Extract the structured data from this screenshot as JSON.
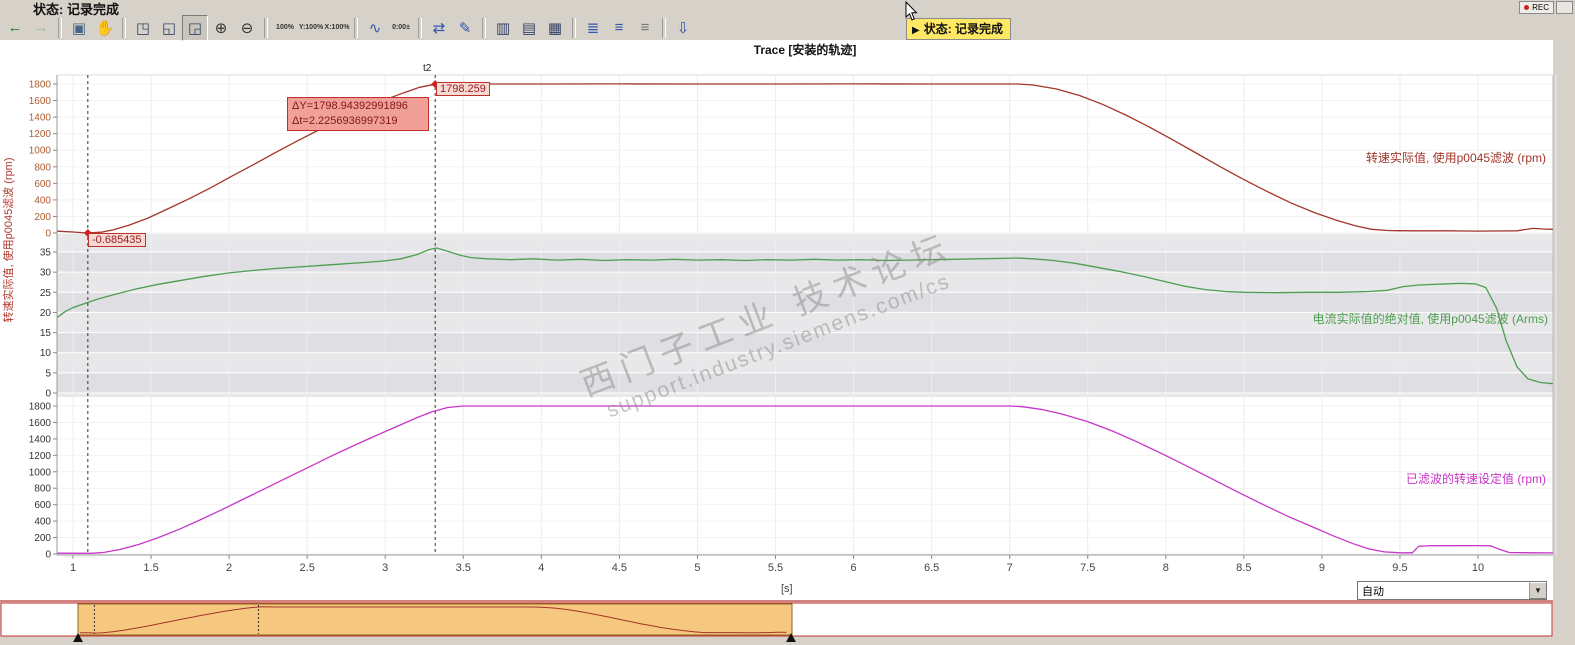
{
  "titlebar": {
    "status_text": "状态: 记录完成",
    "rec_label": "REC"
  },
  "tooltip": {
    "play_glyph": "▶",
    "text": "状态: 记录完成"
  },
  "title": "Trace [安装的轨迹]",
  "left_axis_label": "转速实际值, 使用p0045滤波 (rpm)",
  "toolbar": {
    "buttons": [
      {
        "name": "back-icon",
        "glyph": "←",
        "color": "#1e7d1e"
      },
      {
        "name": "forward-icon",
        "glyph": "→",
        "color": "#8fbf8f"
      },
      {
        "sep": true
      },
      {
        "name": "fit-view-icon",
        "glyph": "▣",
        "color": "#446688"
      },
      {
        "name": "pan-hand-icon",
        "glyph": "✋",
        "color": "#b8860b"
      },
      {
        "sep": true
      },
      {
        "name": "zoom-area-icon",
        "glyph": "◳",
        "color": "#334466"
      },
      {
        "name": "zoom-x-range-icon",
        "glyph": "◱",
        "color": "#334466"
      },
      {
        "name": "zoom-selection-icon",
        "glyph": "◲",
        "color": "#334466",
        "active": true
      },
      {
        "name": "zoom-in-icon",
        "glyph": "⊕",
        "color": "#333333"
      },
      {
        "name": "zoom-out-icon",
        "glyph": "⊖",
        "color": "#333333"
      },
      {
        "sep": true
      },
      {
        "name": "zoom-100-icon",
        "glyph": "100%",
        "color": "#333333",
        "small": true
      },
      {
        "name": "zoom-y-100-icon",
        "glyph": "Y:100%",
        "color": "#333333",
        "small": true
      },
      {
        "name": "zoom-x-100-icon",
        "glyph": "X:100%",
        "color": "#333333",
        "small": true
      },
      {
        "sep": true
      },
      {
        "name": "signal-curve-icon",
        "glyph": "∿",
        "color": "#3355aa"
      },
      {
        "name": "time-offset-icon",
        "glyph": "0:00±",
        "color": "#333333",
        "small": true
      },
      {
        "sep": true
      },
      {
        "name": "swap-axes-icon",
        "glyph": "⇄",
        "color": "#3355aa"
      },
      {
        "name": "draw-line-icon",
        "glyph": "✎",
        "color": "#3355aa"
      },
      {
        "sep": true
      },
      {
        "name": "split-vertical-icon",
        "glyph": "▥",
        "color": "#334466"
      },
      {
        "name": "split-horizontal-icon",
        "glyph": "▤",
        "color": "#334466"
      },
      {
        "name": "zoom-table-icon",
        "glyph": "▦",
        "color": "#334466"
      },
      {
        "sep": true
      },
      {
        "name": "signal-list-icon",
        "glyph": "≣",
        "color": "#3355aa"
      },
      {
        "name": "align-left-icon",
        "glyph": "≡",
        "color": "#3355aa"
      },
      {
        "name": "align-justify-icon",
        "glyph": "≡",
        "color": "#777777"
      },
      {
        "sep": true
      },
      {
        "name": "export-icon",
        "glyph": "⇩",
        "color": "#3355aa"
      }
    ]
  },
  "x_axis": {
    "label": "[s]",
    "ticks": [
      1,
      1.5,
      2,
      2.5,
      3,
      3.5,
      4,
      4.5,
      5,
      5.5,
      6,
      6.5,
      7,
      7.5,
      8,
      8.5,
      9,
      9.5,
      10
    ],
    "xlim": [
      0.9,
      10.5
    ]
  },
  "cursors": {
    "t1": {
      "x": 1.095,
      "value_label": "-0.685435"
    },
    "t2": {
      "x": 3.32,
      "label": "t2",
      "value_label": "1798.259"
    }
  },
  "annotations": {
    "delta_line1": "ΔY=1798.94392991896",
    "delta_line2": "Δt=2.2256936997319"
  },
  "watermark": {
    "line1": "西门子工业  技术论坛",
    "line2": "support.industry.siemens.com/cs"
  },
  "controls": {
    "mode_value": "自动",
    "dropdown_arrow": "▼"
  },
  "chart_data": [
    {
      "type": "line",
      "title": "转速实际值, 使用p0045滤波 (rpm)",
      "color": "#a3352a",
      "label_color": "#b05a2a",
      "ylim": [
        0,
        1800
      ],
      "ytick_step": 200,
      "points": [
        [
          0.9,
          22
        ],
        [
          1.0,
          12
        ],
        [
          1.06,
          4
        ],
        [
          1.1,
          1
        ],
        [
          1.18,
          10
        ],
        [
          1.26,
          40
        ],
        [
          1.36,
          95
        ],
        [
          1.48,
          180
        ],
        [
          1.6,
          285
        ],
        [
          1.74,
          410
        ],
        [
          1.88,
          545
        ],
        [
          2.02,
          690
        ],
        [
          2.16,
          830
        ],
        [
          2.3,
          975
        ],
        [
          2.44,
          1115
        ],
        [
          2.58,
          1250
        ],
        [
          2.72,
          1380
        ],
        [
          2.86,
          1500
        ],
        [
          3.0,
          1610
        ],
        [
          3.12,
          1695
        ],
        [
          3.22,
          1760
        ],
        [
          3.32,
          1798
        ],
        [
          3.38,
          1812
        ],
        [
          3.45,
          1806
        ],
        [
          3.55,
          1800
        ],
        [
          4.0,
          1800
        ],
        [
          4.5,
          1801
        ],
        [
          5.0,
          1800
        ],
        [
          5.5,
          1800
        ],
        [
          6.0,
          1801
        ],
        [
          6.5,
          1800
        ],
        [
          7.0,
          1800
        ],
        [
          7.05,
          1800
        ],
        [
          7.15,
          1788
        ],
        [
          7.3,
          1740
        ],
        [
          7.45,
          1660
        ],
        [
          7.6,
          1550
        ],
        [
          7.75,
          1420
        ],
        [
          7.9,
          1275
        ],
        [
          8.05,
          1120
        ],
        [
          8.2,
          960
        ],
        [
          8.35,
          800
        ],
        [
          8.5,
          645
        ],
        [
          8.65,
          500
        ],
        [
          8.8,
          365
        ],
        [
          8.95,
          248
        ],
        [
          9.1,
          150
        ],
        [
          9.22,
          85
        ],
        [
          9.32,
          45
        ],
        [
          9.42,
          30
        ],
        [
          9.48,
          28
        ],
        [
          9.6,
          27
        ],
        [
          9.8,
          27
        ],
        [
          9.92,
          24
        ],
        [
          10.0,
          23
        ],
        [
          10.1,
          24
        ],
        [
          10.25,
          26
        ],
        [
          10.35,
          55
        ],
        [
          10.42,
          48
        ],
        [
          10.48,
          45
        ]
      ]
    },
    {
      "type": "line",
      "title": "电流实际值的绝对值, 使用p0045滤波 (Arms)",
      "color": "#4d9e50",
      "label_color": "#333333",
      "ylim": [
        0,
        35
      ],
      "ytick_step": 5,
      "points": [
        [
          0.9,
          18.8
        ],
        [
          0.95,
          20.2
        ],
        [
          1.0,
          21.2
        ],
        [
          1.08,
          22.3
        ],
        [
          1.15,
          23.2
        ],
        [
          1.25,
          24.3
        ],
        [
          1.4,
          25.8
        ],
        [
          1.55,
          27.0
        ],
        [
          1.7,
          28.0
        ],
        [
          1.85,
          29.0
        ],
        [
          2.0,
          29.8
        ],
        [
          2.15,
          30.4
        ],
        [
          2.3,
          30.9
        ],
        [
          2.45,
          31.3
        ],
        [
          2.6,
          31.7
        ],
        [
          2.75,
          32.1
        ],
        [
          2.9,
          32.5
        ],
        [
          3.0,
          32.8
        ],
        [
          3.1,
          33.3
        ],
        [
          3.2,
          34.3
        ],
        [
          3.28,
          35.6
        ],
        [
          3.33,
          36.0
        ],
        [
          3.4,
          35.2
        ],
        [
          3.48,
          34.2
        ],
        [
          3.55,
          33.6
        ],
        [
          3.65,
          33.3
        ],
        [
          3.8,
          33.1
        ],
        [
          3.95,
          33.3
        ],
        [
          4.1,
          33.0
        ],
        [
          4.25,
          33.2
        ],
        [
          4.4,
          32.9
        ],
        [
          4.55,
          33.1
        ],
        [
          4.7,
          33.0
        ],
        [
          4.85,
          33.2
        ],
        [
          5.0,
          33.0
        ],
        [
          5.15,
          33.1
        ],
        [
          5.3,
          32.9
        ],
        [
          5.45,
          33.1
        ],
        [
          5.6,
          33.0
        ],
        [
          5.75,
          33.2
        ],
        [
          5.9,
          33.0
        ],
        [
          6.05,
          33.1
        ],
        [
          6.2,
          32.9
        ],
        [
          6.35,
          33.0
        ],
        [
          6.5,
          33.1
        ],
        [
          6.65,
          33.2
        ],
        [
          6.8,
          33.3
        ],
        [
          6.95,
          33.4
        ],
        [
          7.05,
          33.5
        ],
        [
          7.15,
          33.3
        ],
        [
          7.28,
          32.9
        ],
        [
          7.42,
          32.2
        ],
        [
          7.56,
          31.2
        ],
        [
          7.7,
          30.2
        ],
        [
          7.85,
          29.0
        ],
        [
          8.0,
          27.6
        ],
        [
          8.12,
          26.5
        ],
        [
          8.25,
          25.7
        ],
        [
          8.38,
          25.2
        ],
        [
          8.5,
          25.0
        ],
        [
          8.7,
          24.9
        ],
        [
          8.9,
          25.0
        ],
        [
          9.1,
          25.0
        ],
        [
          9.3,
          25.2
        ],
        [
          9.42,
          25.5
        ],
        [
          9.52,
          26.4
        ],
        [
          9.62,
          26.8
        ],
        [
          9.75,
          27.0
        ],
        [
          9.88,
          27.2
        ],
        [
          9.98,
          27.1
        ],
        [
          10.05,
          26.2
        ],
        [
          10.12,
          21.0
        ],
        [
          10.18,
          13.0
        ],
        [
          10.25,
          6.5
        ],
        [
          10.32,
          3.5
        ],
        [
          10.4,
          2.6
        ],
        [
          10.48,
          2.3
        ]
      ]
    },
    {
      "type": "line",
      "title": "已滤波的转速设定值 (rpm)",
      "color": "#c835c8",
      "label_color": "#333333",
      "ylim": [
        0,
        1800
      ],
      "ytick_step": 200,
      "points": [
        [
          0.9,
          10
        ],
        [
          1.05,
          9
        ],
        [
          1.12,
          8
        ],
        [
          1.2,
          20
        ],
        [
          1.3,
          55
        ],
        [
          1.42,
          115
        ],
        [
          1.54,
          195
        ],
        [
          1.68,
          300
        ],
        [
          1.82,
          420
        ],
        [
          1.96,
          545
        ],
        [
          2.1,
          675
        ],
        [
          2.24,
          805
        ],
        [
          2.38,
          935
        ],
        [
          2.52,
          1065
        ],
        [
          2.66,
          1195
        ],
        [
          2.8,
          1320
        ],
        [
          2.94,
          1440
        ],
        [
          3.08,
          1555
        ],
        [
          3.2,
          1655
        ],
        [
          3.3,
          1730
        ],
        [
          3.4,
          1782
        ],
        [
          3.5,
          1800
        ],
        [
          4.0,
          1800
        ],
        [
          5.0,
          1800
        ],
        [
          6.0,
          1800
        ],
        [
          7.0,
          1800
        ],
        [
          7.08,
          1792
        ],
        [
          7.2,
          1760
        ],
        [
          7.34,
          1700
        ],
        [
          7.5,
          1610
        ],
        [
          7.66,
          1495
        ],
        [
          7.82,
          1360
        ],
        [
          7.98,
          1215
        ],
        [
          8.14,
          1065
        ],
        [
          8.3,
          910
        ],
        [
          8.46,
          755
        ],
        [
          8.62,
          605
        ],
        [
          8.78,
          460
        ],
        [
          8.94,
          330
        ],
        [
          9.08,
          215
        ],
        [
          9.2,
          125
        ],
        [
          9.3,
          62
        ],
        [
          9.4,
          25
        ],
        [
          9.5,
          14
        ],
        [
          9.58,
          14
        ],
        [
          9.62,
          95
        ],
        [
          9.7,
          102
        ],
        [
          9.85,
          101
        ],
        [
          10.0,
          102
        ],
        [
          10.08,
          100
        ],
        [
          10.14,
          55
        ],
        [
          10.2,
          18
        ],
        [
          10.35,
          14
        ],
        [
          10.48,
          13
        ]
      ]
    }
  ]
}
